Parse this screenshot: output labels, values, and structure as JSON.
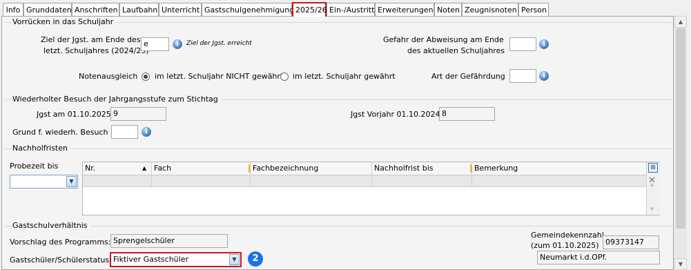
{
  "tabs": [
    "Info",
    "Grunddaten",
    "Anschriften",
    "Laufbahn",
    "Unterricht",
    "Gastschulgenehmigung",
    "2025/26",
    "Ein-/Austritt",
    "Erweiterungen",
    "Noten",
    "Zeugnisnoten",
    "Person"
  ],
  "active_tab": "2025/26",
  "vorruecken": {
    "section": "Vorrücken in das Schuljahr",
    "ziel_label_1": "Ziel der Jgst. am Ende des",
    "ziel_label_2": "letzt. Schuljahres (2024/25)",
    "ziel_value": "e",
    "ziel_hint": "Ziel der Jgst. erreicht",
    "gefahr_label_1": "Gefahr der Abweisung am Ende",
    "gefahr_label_2": "des aktuellen Schuljahres",
    "gefahr_value": "",
    "notenausgleich_label": "Notenausgleich",
    "radio_not_granted": "im letzt. Schuljahr NICHT gewährt",
    "radio_granted": "im letzt. Schuljahr gewährt",
    "selected_radio": "not_granted",
    "art_label": "Art der Gefährdung",
    "art_value": ""
  },
  "wiederholt": {
    "section": "Wiederholter Besuch der Jahrgangsstufe zum Stichtag",
    "jgst_label": "Jgst am 01.10.2025",
    "jgst_value": "9",
    "vorjahr_label": "Jgst Vorjahr 01.10.2024",
    "vorjahr_value": "8",
    "grund_label": "Grund f. wiederh. Besuch",
    "grund_value": ""
  },
  "nachhol": {
    "section": "Nachholfristen",
    "probezeit_label": "Probezeit bis",
    "probezeit_value": "",
    "columns": [
      "Nr.",
      "Fach",
      "Fachbezeichnung",
      "Nachholfrist bis",
      "Bemerkung"
    ]
  },
  "gast": {
    "section": "Gastschulverhältnis",
    "vorschlag_label": "Vorschlag des Programms:",
    "vorschlag_value": "Sprengelschüler",
    "status_label": "Gastschüler/Schülerstatus",
    "status_value": "Fiktiver Gastschüler",
    "gemeinde_label_1": "Gemeindekennzahl",
    "gemeinde_label_2": "(zum 01.10.2025)",
    "gemeinde_value": "09373147",
    "ort_value": "Neumarkt i.d.OPf."
  },
  "badge_number": "2",
  "colors": {
    "highlight": "#c4161c",
    "badge": "#1a73e8",
    "column_separator": "#f2b646"
  }
}
